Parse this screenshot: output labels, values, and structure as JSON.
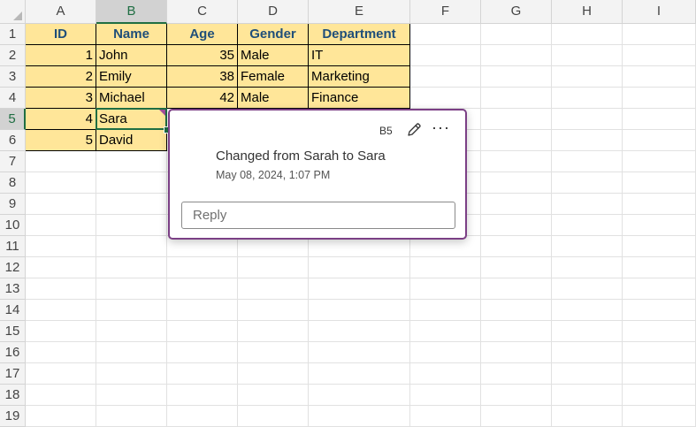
{
  "columns": [
    "A",
    "B",
    "C",
    "D",
    "E",
    "F",
    "G",
    "H",
    "I"
  ],
  "rows": [
    "1",
    "2",
    "3",
    "4",
    "5",
    "6",
    "7",
    "8",
    "9",
    "10",
    "11",
    "12",
    "13",
    "14",
    "15",
    "16",
    "17",
    "18",
    "19"
  ],
  "selected": {
    "column": "B",
    "row": "5"
  },
  "table": {
    "headers": [
      "ID",
      "Name",
      "Age",
      "Gender",
      "Department"
    ],
    "rows": [
      [
        "1",
        "John",
        "35",
        "Male",
        "IT"
      ],
      [
        "2",
        "Emily",
        "38",
        "Female",
        "Marketing"
      ],
      [
        "3",
        "Michael",
        "42",
        "Male",
        "Finance"
      ],
      [
        "4",
        "Sara",
        "",
        "",
        ""
      ],
      [
        "5",
        "David",
        "",
        "",
        ""
      ]
    ]
  },
  "comment": {
    "cell_ref": "B5",
    "edit_icon": "pencil-icon",
    "more_icon": "more-options-icon",
    "more_label": "···",
    "text": "Changed from Sarah to Sara",
    "timestamp": "May 08, 2024, 1:07 PM",
    "reply_placeholder": "Reply"
  },
  "colors": {
    "table_fill": "#ffe699",
    "header_text": "#1f4e79",
    "selection": "#1f6e43",
    "comment_border": "#7b3f85"
  }
}
